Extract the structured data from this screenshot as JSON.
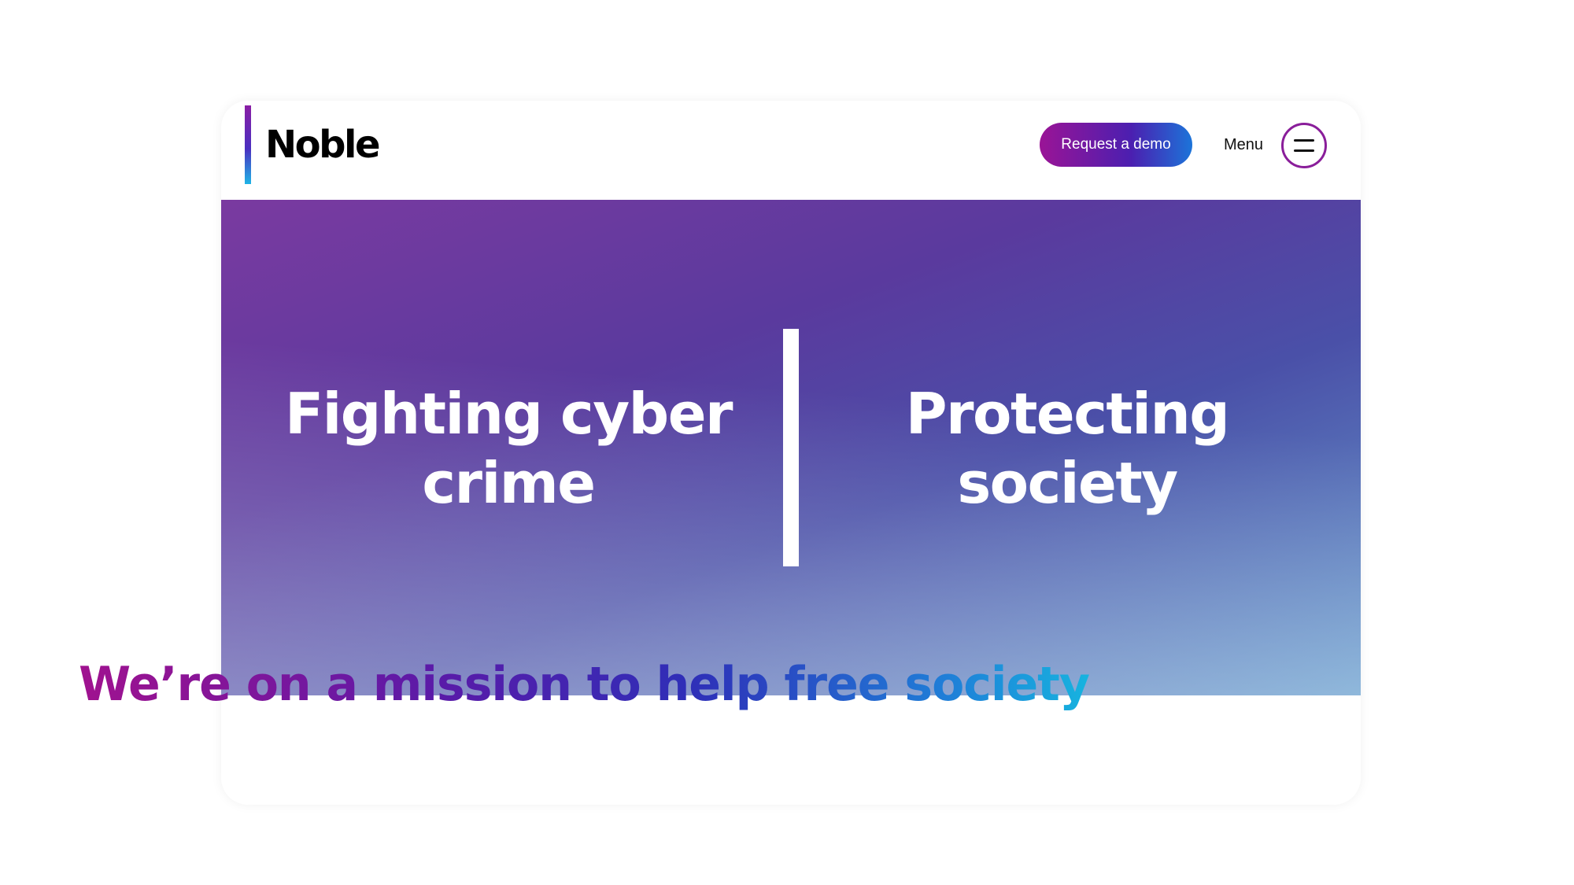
{
  "header": {
    "logo_text": "Noble",
    "demo_label": "Request a demo",
    "menu_label": "Menu"
  },
  "hero": {
    "left_heading": "Fighting cyber crime",
    "right_heading": "Protecting society"
  },
  "mission": {
    "heading": "We’re on a mission to help free society"
  },
  "colors": {
    "brand_purple": "#8a1e9a",
    "brand_blue": "#1c74d9",
    "brand_cyan": "#16b8e0"
  },
  "icons": {
    "menu": "hamburger-icon"
  }
}
